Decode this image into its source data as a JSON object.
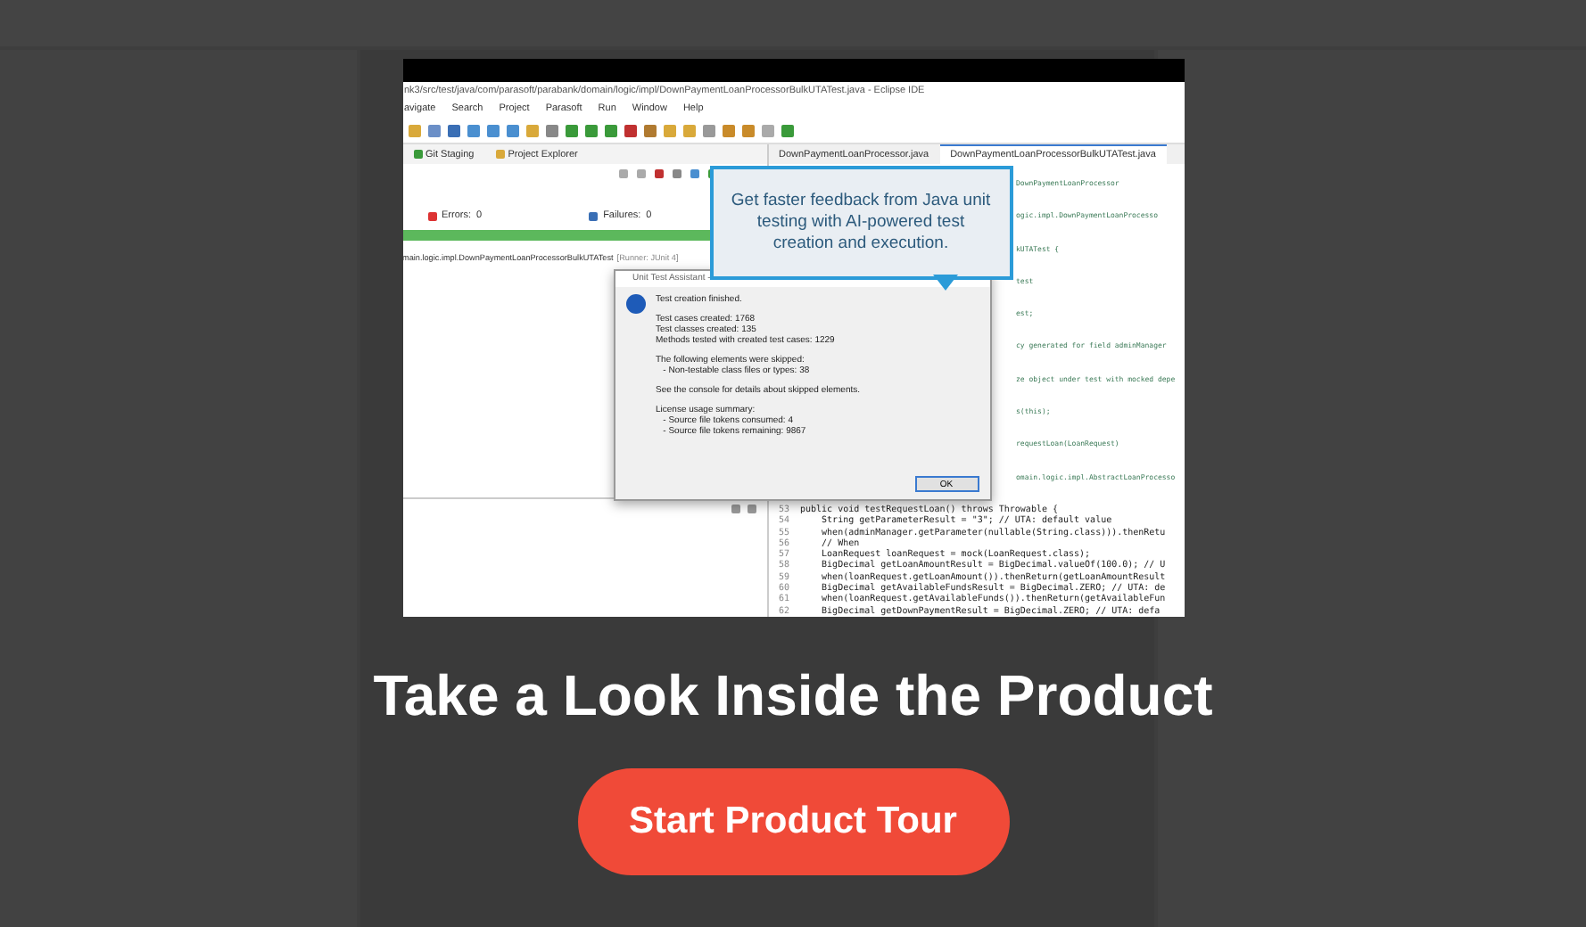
{
  "screenshot": {
    "title_bar": "nk3/src/test/java/com/parasoft/parabank/domain/logic/impl/DownPaymentLoanProcessorBulkUTATest.java - Eclipse IDE",
    "menu": [
      "avigate",
      "Search",
      "Project",
      "Parasoft",
      "Run",
      "Window",
      "Help"
    ],
    "left_tabs": [
      "Git Staging",
      "Project Explorer"
    ],
    "errors": "Errors:",
    "errors_count": "0",
    "failures": "Failures:",
    "failures_count": "0",
    "progress": {
      "level": 1
    },
    "test_run": "main.logic.impl.DownPaymentLoanProcessorBulkUTATest",
    "runner": "[Runner: JUnit 4]",
    "editor_tabs": [
      {
        "label": "DownPaymentLoanProcessor.java",
        "selected": false
      },
      {
        "label": "DownPaymentLoanProcessorBulkUTATest.java",
        "selected": true
      }
    ],
    "code_lines": [
      {
        "kind": "partial",
        "text": "DownPaymentLoanProcessor"
      },
      {
        "kind": "partial",
        "text": "ogic.impl.DownPaymentLoanProcesso"
      },
      {
        "kind": "partial",
        "text": "kUTATest {"
      },
      {
        "kind": "partial",
        "text": "test"
      },
      {
        "kind": "partial",
        "text": "est;"
      },
      {
        "kind": "partial",
        "text": "cy generated for field adminManager"
      },
      {
        "kind": "partial",
        "text": "ze object under test with mocked depe"
      },
      {
        "kind": "partial",
        "text": "s(this);"
      },
      {
        "kind": "partial",
        "text": "requestLoan(LoanRequest)"
      },
      {
        "kind": "partial",
        "text": "omain.logic.impl.AbstractLoanProcesso"
      },
      {
        "kind": "full",
        "number": "53",
        "text": "public void testRequestLoan() throws Throwable {"
      },
      {
        "kind": "full",
        "number": "54",
        "text": "    String getParameterResult = \"3\"; // UTA: default value"
      },
      {
        "kind": "full",
        "number": "55",
        "text": "    when(adminManager.getParameter(nullable(String.class))).thenRetu"
      },
      {
        "kind": "full",
        "number": "56",
        "text": "    // When"
      },
      {
        "kind": "full",
        "number": "57",
        "text": "    LoanRequest loanRequest = mock(LoanRequest.class);"
      },
      {
        "kind": "full",
        "number": "58",
        "text": "    BigDecimal getLoanAmountResult = BigDecimal.valueOf(100.0); // U"
      },
      {
        "kind": "full",
        "number": "59",
        "text": "    when(loanRequest.getLoanAmount()).thenReturn(getLoanAmountResult"
      },
      {
        "kind": "full",
        "number": "60",
        "text": "    BigDecimal getAvailableFundsResult = BigDecimal.ZERO; // UTA: de"
      },
      {
        "kind": "full",
        "number": "61",
        "text": "    when(loanRequest.getAvailableFunds()).thenReturn(getAvailableFun"
      },
      {
        "kind": "full",
        "number": "62",
        "text": "    BigDecimal getDownPaymentResult = BigDecimal.ZERO; // UTA: defa"
      }
    ],
    "dialog": {
      "title": "Unit Test Assistant -",
      "paragraphs": [
        [
          "Test creation finished."
        ],
        [
          "Test cases created: 1768",
          "Test classes created: 135",
          "Methods tested with created test cases: 1229"
        ],
        [
          "The following elements were skipped:",
          "   - Non-testable class files or types: 38"
        ],
        [
          "See the console for details about skipped elements."
        ],
        [
          "License usage summary:",
          "   - Source file tokens consumed: 4",
          "   - Source file tokens remaining: 9867"
        ]
      ],
      "button": "OK"
    },
    "callout": "Get faster feedback from Java unit testing with AI-powered test creation and execution."
  },
  "heading": "Take a Look Inside the Product",
  "cta_button": "Start Product Tour"
}
